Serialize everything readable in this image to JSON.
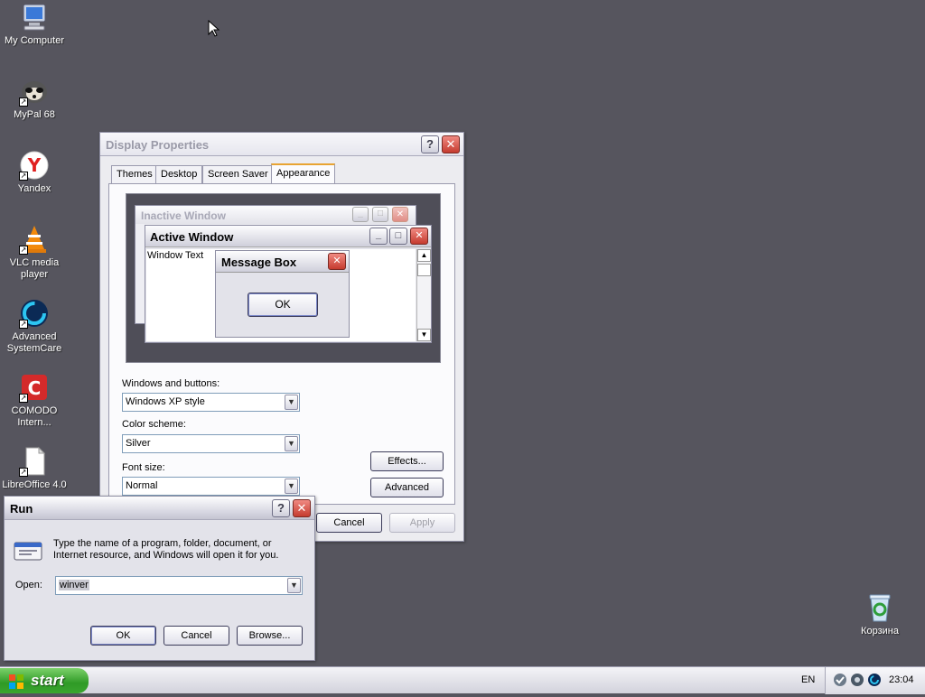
{
  "desktop": {
    "icons": [
      {
        "label": "My Computer",
        "icon": "computer-icon"
      },
      {
        "label": "MyPal 68",
        "icon": "mypal-icon"
      },
      {
        "label": "Yandex",
        "icon": "yandex-icon"
      },
      {
        "label": "VLC media player",
        "icon": "vlc-icon"
      },
      {
        "label": "Advanced SystemCare",
        "icon": "systemcare-icon"
      },
      {
        "label": "COMODO Intern...",
        "icon": "comodo-icon"
      },
      {
        "label": "LibreOffice 4.0",
        "icon": "libreoffice-icon"
      }
    ],
    "recycle_bin": {
      "label": "Корзина",
      "icon": "recycle-bin-icon"
    }
  },
  "display_properties": {
    "title": "Display Properties",
    "tabs": [
      "Themes",
      "Desktop",
      "Screen Saver",
      "Appearance"
    ],
    "active_tab": "Appearance",
    "preview": {
      "inactive_window_title": "Inactive Window",
      "active_window_title": "Active Window",
      "window_text": "Window Text",
      "message_box_title": "Message Box",
      "message_box_ok": "OK"
    },
    "windows_and_buttons": {
      "label": "Windows and buttons:",
      "value": "Windows XP style"
    },
    "color_scheme": {
      "label": "Color scheme:",
      "value": "Silver"
    },
    "font_size": {
      "label": "Font size:",
      "value": "Normal"
    },
    "effects_button": "Effects...",
    "advanced_button": "Advanced",
    "cancel_button": "Cancel",
    "apply_button": "Apply"
  },
  "run": {
    "title": "Run",
    "description": "Type the name of a program, folder, document, or Internet resource, and Windows will open it for you.",
    "open_label": "Open:",
    "open_value": "winver",
    "ok_button": "OK",
    "cancel_button": "Cancel",
    "browse_button": "Browse..."
  },
  "taskbar": {
    "start_label": "start",
    "language": "EN",
    "clock": "23:04"
  },
  "colors": {
    "desktop_background": "#56555e",
    "start_button": "#3aa62f",
    "close_button": "#c53b2f"
  }
}
